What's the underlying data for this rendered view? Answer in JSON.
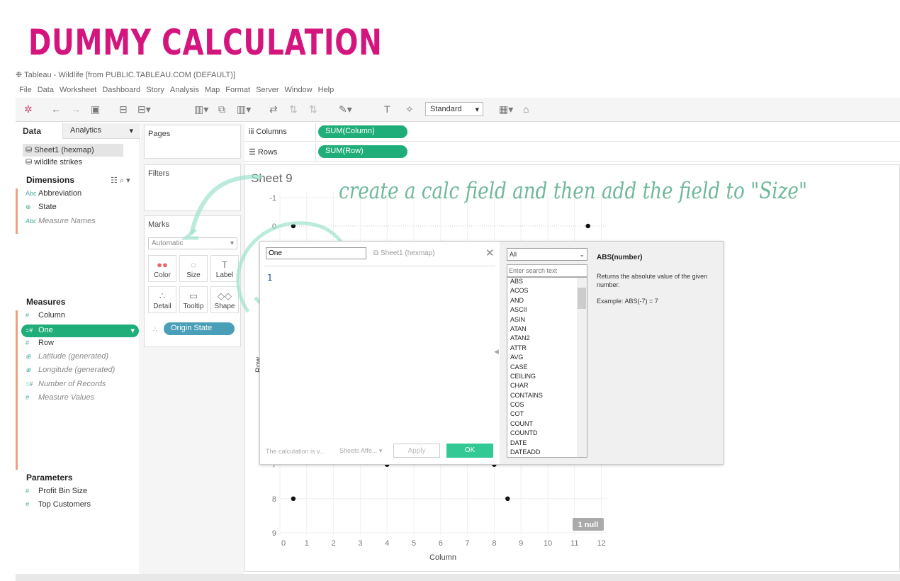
{
  "banner": "DUMMY CALCULATION",
  "window_title": "Tableau - Wildlife [from PUBLIC.TABLEAU.COM (DEFAULT)]",
  "menu": [
    "File",
    "Data",
    "Worksheet",
    "Dashboard",
    "Story",
    "Analysis",
    "Map",
    "Format",
    "Server",
    "Window",
    "Help"
  ],
  "toolbar": {
    "fit_select": "Standard"
  },
  "left": {
    "tabs": [
      "Data",
      "Analytics"
    ],
    "datasources": [
      "Sheet1 (hexmap)",
      "wildlife strikes"
    ],
    "dimensions_title": "Dimensions",
    "dimensions": [
      {
        "icon": "Abc",
        "label": "Abbreviation",
        "italic": false
      },
      {
        "icon": "⊕",
        "label": "State",
        "italic": false
      },
      {
        "icon": "Abc",
        "label": "Measure Names",
        "italic": true
      }
    ],
    "measures_title": "Measures",
    "measures": [
      {
        "icon": "#",
        "label": "Column",
        "italic": false
      },
      {
        "icon": "=#",
        "label": "One",
        "italic": false,
        "selected": true
      },
      {
        "icon": "#",
        "label": "Row",
        "italic": false
      },
      {
        "icon": "⊕",
        "label": "Latitude (generated)",
        "italic": true
      },
      {
        "icon": "⊕",
        "label": "Longitude (generated)",
        "italic": true
      },
      {
        "icon": "=#",
        "label": "Number of Records",
        "italic": true
      },
      {
        "icon": "#",
        "label": "Measure Values",
        "italic": true
      }
    ],
    "parameters_title": "Parameters",
    "parameters": [
      {
        "icon": "#",
        "label": "Profit Bin Size"
      },
      {
        "icon": "#",
        "label": "Top Customers"
      }
    ]
  },
  "cards": {
    "pages": "Pages",
    "filters": "Filters",
    "marks": "Marks",
    "mark_type": "Automatic",
    "buttons": [
      {
        "label": "Color",
        "icon": "●●"
      },
      {
        "label": "Size",
        "icon": "◌"
      },
      {
        "label": "Label",
        "icon": "T"
      },
      {
        "label": "Detail",
        "icon": "∴"
      },
      {
        "label": "Tooltip",
        "icon": "▭"
      },
      {
        "label": "Shape",
        "icon": "◇◇"
      }
    ],
    "mark_pill": "Origin State"
  },
  "shelves": {
    "columns_label": "Columns",
    "columns_pill": "SUM(Column)",
    "rows_label": "Rows",
    "rows_pill": "SUM(Row)"
  },
  "sheet_title": "Sheet 9",
  "annotation": "create a calc field and then add the field to \"Size\"",
  "chart_data": {
    "type": "scatter",
    "xlabel": "Column",
    "ylabel": "Row",
    "x_ticks": [
      0,
      1,
      2,
      3,
      4,
      5,
      6,
      7,
      8,
      9,
      10,
      11,
      12
    ],
    "y_ticks": [
      -1,
      0,
      7,
      8,
      9
    ],
    "xlim": [
      0,
      12
    ],
    "ylim": [
      -1,
      9
    ],
    "y_reversed": true,
    "points": [
      {
        "x": 0.5,
        "y": 0
      },
      {
        "x": 11.5,
        "y": 0
      },
      {
        "x": 4,
        "y": 7
      },
      {
        "x": 8,
        "y": 7
      },
      {
        "x": 0.5,
        "y": 8
      },
      {
        "x": 8.5,
        "y": 8
      }
    ],
    "null_badge": "1 null"
  },
  "dialog": {
    "name_value": "One",
    "datasource": "Sheet1 (hexmap)",
    "formula": "1",
    "status": "The calculation is v...",
    "sheets_affected": "Sheets Affe...",
    "apply": "Apply",
    "ok": "OK",
    "category": "All",
    "search_placeholder": "Enter search text",
    "functions": [
      "ABS",
      "ACOS",
      "AND",
      "ASCII",
      "ASIN",
      "ATAN",
      "ATAN2",
      "ATTR",
      "AVG",
      "CASE",
      "CEILING",
      "CHAR",
      "CONTAINS",
      "COS",
      "COT",
      "COUNT",
      "COUNTD",
      "DATE",
      "DATEADD"
    ],
    "help_title": "ABS(number)",
    "help_desc": "Returns the absolute value of the given number.",
    "help_example": "Example: ABS(-7) = 7"
  },
  "colors": {
    "accent": "#1fae7a",
    "banner": "#d4157d",
    "annotation": "#6fb89a",
    "ok": "#33c994"
  }
}
